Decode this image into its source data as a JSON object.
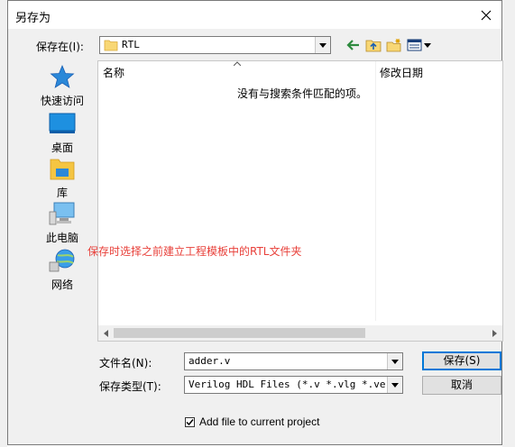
{
  "window": {
    "title": "另存为"
  },
  "toolbar": {
    "save_in_label": "保存在(I):",
    "save_in_value": "RTL"
  },
  "places": [
    {
      "label": "快速访问",
      "icon": "star-icon"
    },
    {
      "label": "桌面",
      "icon": "desktop-icon"
    },
    {
      "label": "库",
      "icon": "library-folder-icon"
    },
    {
      "label": "此电脑",
      "icon": "computer-icon"
    },
    {
      "label": "网络",
      "icon": "network-icon"
    }
  ],
  "filelist": {
    "columns": [
      "名称",
      "修改日期"
    ],
    "empty_message": "没有与搜索条件匹配的项。"
  },
  "annotation": "保存时选择之前建立工程模板中的RTL文件夹",
  "form": {
    "filename_label": "文件名(N):",
    "filename_value": "adder.v",
    "filetype_label": "保存类型(T):",
    "filetype_value": "Verilog HDL Files (*.v *.vlg *.verilo",
    "save_button": "保存(S)",
    "cancel_button": "取消",
    "add_to_project_label": "Add file to current project",
    "add_to_project_checked": true
  },
  "colors": {
    "accent": "#0078d7",
    "annotation": "#e8403a",
    "folder": "#f5c542"
  }
}
